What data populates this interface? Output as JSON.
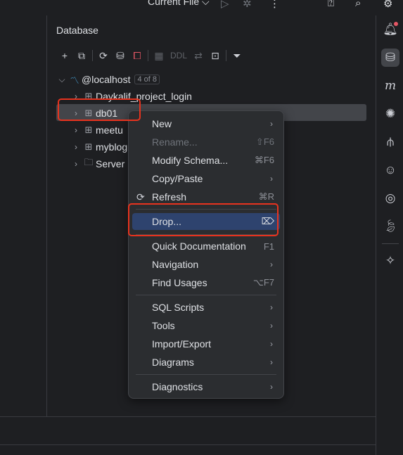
{
  "topbar": {
    "current_file": "Current File ⌵",
    "icons": [
      "run-icon",
      "debug-icon",
      "more-icon",
      "add-user-icon",
      "search-icon",
      "settings-icon"
    ]
  },
  "panel": {
    "title": "Database",
    "toolbar": {
      "ddl_label": "DDL"
    }
  },
  "tree": {
    "root": {
      "label": "@localhost",
      "badge": "4 of 8"
    },
    "items": [
      {
        "label": "Daykalif_project_login"
      },
      {
        "label": "db01"
      },
      {
        "label": "meetu"
      },
      {
        "label": "myblog"
      },
      {
        "label": "Server"
      }
    ]
  },
  "context_menu": {
    "items": [
      {
        "label": "New",
        "shortcut": "",
        "submenu": true
      },
      {
        "label": "Rename...",
        "shortcut": "⇧F6",
        "disabled": true
      },
      {
        "label": "Modify Schema...",
        "shortcut": "⌘F6"
      },
      {
        "label": "Copy/Paste",
        "shortcut": "",
        "submenu": true
      },
      {
        "label": "Refresh",
        "shortcut": "⌘R"
      },
      {
        "label": "Drop...",
        "shortcut": "⌦",
        "active": true
      },
      {
        "label": "Quick Documentation",
        "shortcut": "F1"
      },
      {
        "label": "Navigation",
        "shortcut": "",
        "submenu": true
      },
      {
        "label": "Find Usages",
        "shortcut": "⌥F7"
      },
      {
        "label": "SQL Scripts",
        "shortcut": "",
        "submenu": true
      },
      {
        "label": "Tools",
        "shortcut": "",
        "submenu": true
      },
      {
        "label": "Import/Export",
        "shortcut": "",
        "submenu": true
      },
      {
        "label": "Diagrams",
        "shortcut": "",
        "submenu": true
      },
      {
        "label": "Diagnostics",
        "shortcut": "",
        "submenu": true
      }
    ]
  },
  "colors": {
    "highlight_border": "#e8331e",
    "active_menu_bg": "#2e436e",
    "background": "#1e1f22",
    "menu_bg": "#2b2d30"
  }
}
